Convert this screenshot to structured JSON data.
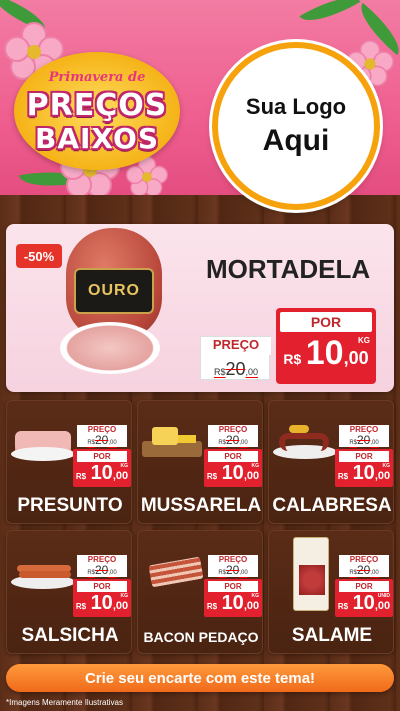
{
  "header": {
    "badge_line1": "Primavera de",
    "badge_line2": "PREÇOS",
    "badge_line3": "BAIXOS",
    "logo_line1": "Sua Logo",
    "logo_line2": "Aqui"
  },
  "featured": {
    "discount": "-50%",
    "brand": "OURO",
    "name": "MORTADELA",
    "preco_label": "PREÇO",
    "old_currency": "R$",
    "old_int": "20",
    "old_dec": ",00",
    "por_label": "POR",
    "currency": "R$",
    "price_int": "10",
    "price_dec": ",00",
    "unit": "KG"
  },
  "products": [
    {
      "name": "PRESUNTO",
      "preco_label": "PREÇO",
      "old_currency": "R$",
      "old_int": "20",
      "old_dec": ",00",
      "por_label": "POR",
      "currency": "R$",
      "price_int": "10",
      "price_dec": ",00",
      "unit": "KG"
    },
    {
      "name": "MUSSARELA",
      "preco_label": "PREÇO",
      "old_currency": "R$",
      "old_int": "20",
      "old_dec": ",00",
      "por_label": "POR",
      "currency": "R$",
      "price_int": "10",
      "price_dec": ",00",
      "unit": "KG"
    },
    {
      "name": "CALABRESA",
      "preco_label": "PREÇO",
      "old_currency": "R$",
      "old_int": "20",
      "old_dec": ",00",
      "por_label": "POR",
      "currency": "R$",
      "price_int": "10",
      "price_dec": ",00",
      "unit": "KG"
    },
    {
      "name": "SALSICHA",
      "preco_label": "PREÇO",
      "old_currency": "R$",
      "old_int": "20",
      "old_dec": ",00",
      "por_label": "POR",
      "currency": "R$",
      "price_int": "10",
      "price_dec": ",00",
      "unit": "KG"
    },
    {
      "name": "BACON PEDAÇO",
      "preco_label": "PREÇO",
      "old_currency": "R$",
      "old_int": "20",
      "old_dec": ",00",
      "por_label": "POR",
      "currency": "R$",
      "price_int": "10",
      "price_dec": ",00",
      "unit": "KG"
    },
    {
      "name": "SALAME",
      "preco_label": "PREÇO",
      "old_currency": "R$",
      "old_int": "20",
      "old_dec": ",00",
      "por_label": "POR",
      "currency": "R$",
      "price_int": "10",
      "price_dec": ",00",
      "unit": "UNID"
    }
  ],
  "cta": {
    "label": "Crie seu encarte com este tema!"
  },
  "disclaimer": "*Imagens Meramente Ilustrativas",
  "colors": {
    "pink": "#ef5f8f",
    "red": "#e3202d",
    "orange": "#f06a1a",
    "wood": "#5b2d17",
    "gold": "#f5b317"
  }
}
